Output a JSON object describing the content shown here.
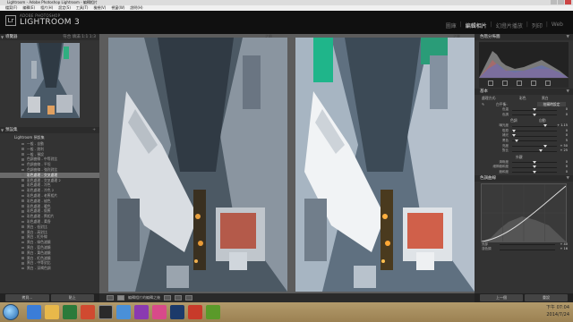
{
  "window": {
    "title": "Lightroom - Adobe Photoshop Lightroom - 編輯相片"
  },
  "menu": [
    "檔案(F)",
    "編輯(E)",
    "相片(H)",
    "設定(S)",
    "工具(T)",
    "檢視(V)",
    "視窗(W)",
    "說明(H)"
  ],
  "brand": {
    "logo": "Lr",
    "top": "ADOBE PHOTOSHOP",
    "main": "LIGHTROOM 3"
  },
  "modules": [
    "圖庫",
    "編輯相片",
    "幻燈片播放",
    "列印",
    "Web"
  ],
  "modules_active": "編輯相片",
  "left": {
    "navigator_title": "導覽器",
    "navigator_right": "符合 填滿 1:1 1:3",
    "presets_title": "預設集",
    "presets_folder": "Lightroom 預設集",
    "presets": [
      "一般 - 自動",
      "一般 - 銳利",
      "一般 - 預設",
      "色調曲線 - 中等對比",
      "色調曲線 - 平坦",
      "色調曲線 - 強烈對比",
      "彩色處理 - 交叉處理",
      "彩色處理 - 交叉處理 2",
      "彩色處理 - 冷色",
      "彩色處理 - 冷色 2",
      "彩色處理 - 老舊相片",
      "彩色處理 - 褪色",
      "彩色處理 - 暖色",
      "彩色處理 - 懷舊",
      "彩色處理 - 舊相片",
      "彩色處理 - 黃昏",
      "黑白 - 低對比",
      "黑白 - 高對比",
      "黑白 - 紅外線",
      "黑白 - 綠色濾鏡",
      "黑白 - 藍色濾鏡",
      "黑白 - 黃色濾鏡",
      "黑白 - 紅色濾鏡",
      "黑白 - 中等對比",
      "黑白 - 深褐色調"
    ],
    "selected_preset_index": 6,
    "btn_copy": "拷貝...",
    "btn_paste": "貼上"
  },
  "center": {
    "before_label": "之前",
    "after_label": "之後",
    "toolbar_text": "編輯相片的編輯之後"
  },
  "right": {
    "histogram_title": "色階分佈圖",
    "basic_title": "基本",
    "treatment_label": "處理方式:",
    "treatment_color": "彩色",
    "treatment_bw": "黑白",
    "wb_label": "白平衡:",
    "wb_value": "拍攝時設定",
    "tone_label": "色調",
    "tone_auto": "自動",
    "presence_label": "外觀",
    "basic_rows": [
      {
        "label": "色溫",
        "value": "0"
      },
      {
        "label": "色調",
        "value": "0"
      },
      {
        "label": "曝光度",
        "value": "+ 1.15"
      },
      {
        "label": "復原",
        "value": "0"
      },
      {
        "label": "補光",
        "value": "0"
      },
      {
        "label": "黑色",
        "value": "5"
      },
      {
        "label": "亮度",
        "value": "+ 50"
      },
      {
        "label": "對比",
        "value": "+ 25"
      },
      {
        "label": "清晰度",
        "value": "0"
      },
      {
        "label": "細節飽和度",
        "value": "0"
      },
      {
        "label": "飽和度",
        "value": "0"
      }
    ],
    "curve_title": "色調曲線",
    "curve_rows": [
      {
        "label": "亮部",
        "value": "+ 40"
      },
      {
        "label": "淺色調",
        "value": "+ 16"
      }
    ],
    "btn_prev": "上一個",
    "btn_reset": "重設"
  },
  "taskbar": {
    "time": "下午 07:04",
    "date": "2014/7/24"
  }
}
